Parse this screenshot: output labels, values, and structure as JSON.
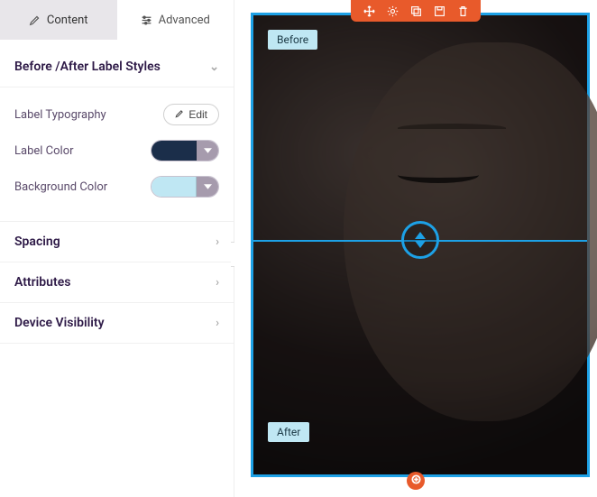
{
  "tabs": {
    "content": "Content",
    "advanced": "Advanced"
  },
  "sections": {
    "label_styles": "Before /After Label Styles",
    "spacing": "Spacing",
    "attributes": "Attributes",
    "device_visibility": "Device Visibility"
  },
  "controls": {
    "typography_label": "Label Typography",
    "edit_btn": "Edit",
    "label_color_label": "Label Color",
    "label_color_value": "#1b2e4a",
    "background_color_label": "Background Color",
    "background_color_value": "#bfe7f3"
  },
  "preview": {
    "before_label": "Before",
    "after_label": "After"
  },
  "colors": {
    "accent": "#1da1e6",
    "toolbar": "#e85a2b"
  }
}
